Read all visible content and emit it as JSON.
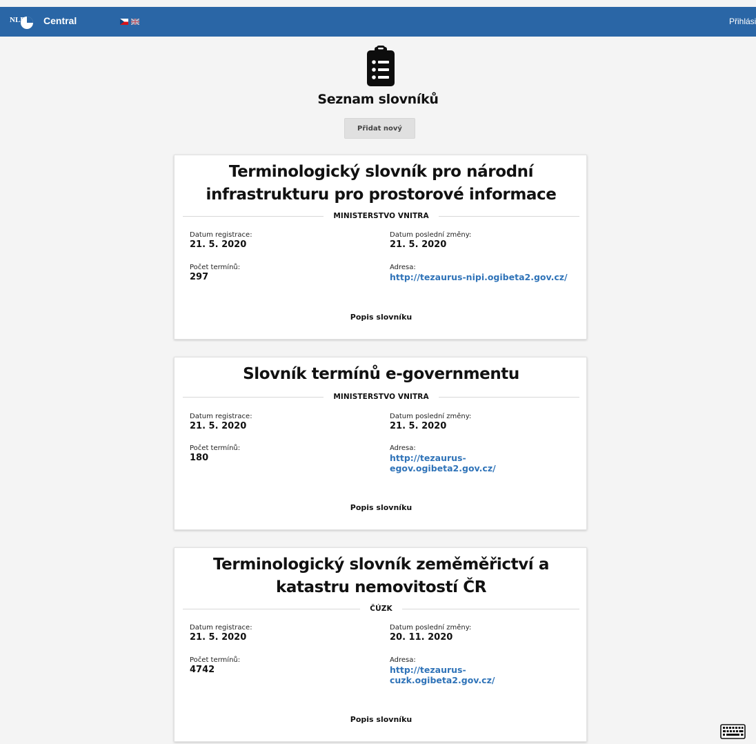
{
  "header": {
    "brand": "Central",
    "logo_text": "NLP",
    "login_label": "Přihlásit",
    "flags": [
      "cz-flag-icon",
      "gb-flag-icon"
    ]
  },
  "page": {
    "title": "Seznam slovníků",
    "add_button": "Přidat nový",
    "icon": "clipboard-list-icon"
  },
  "labels": {
    "registered": "Datum registrace:",
    "last_change": "Datum poslední změny:",
    "term_count": "Počet termínů:",
    "address": "Adresa:",
    "description": "Popis slovníku"
  },
  "dictionaries": [
    {
      "title_line1": "Terminologický slovník pro národní",
      "title_line2": "infrastrukturu pro prostorové informace",
      "organization": "MINISTERSTVO VNITRA",
      "registered": "21. 5. 2020",
      "last_change": "21. 5. 2020",
      "term_count": "297",
      "address_line1": "http://tezaurus-nipi.ogibeta2.gov.cz/",
      "address_line2": ""
    },
    {
      "title_line1": "Slovník termínů e-governmentu",
      "title_line2": "",
      "organization": "MINISTERSTVO VNITRA",
      "registered": "21. 5. 2020",
      "last_change": "21. 5. 2020",
      "term_count": "180",
      "address_line1": "http://tezaurus-",
      "address_line2": "egov.ogibeta2.gov.cz/"
    },
    {
      "title_line1": "Terminologický slovník zeměměřictví a",
      "title_line2": "katastru nemovitostí ČR",
      "organization": "ČÚZK",
      "registered": "21. 5. 2020",
      "last_change": "20. 11. 2020",
      "term_count": "4742",
      "address_line1": "http://tezaurus-",
      "address_line2": "cuzk.ogibeta2.gov.cz/"
    }
  ],
  "footer": {
    "icon": "keyboard-icon"
  },
  "colors": {
    "header": "#2a66a6",
    "link": "#2f73b8",
    "background": "#f4f4f4"
  }
}
